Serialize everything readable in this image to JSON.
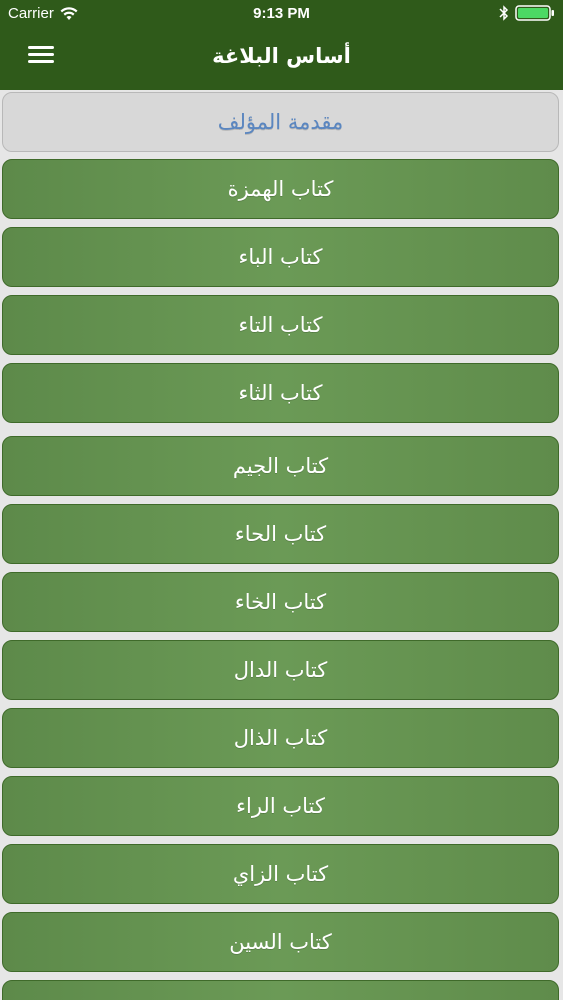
{
  "status_bar": {
    "carrier": "Carrier",
    "time": "9:13 PM",
    "icons": [
      "wifi-icon",
      "bluetooth-icon",
      "battery-icon"
    ]
  },
  "nav": {
    "title": "أساس البلاغة",
    "menu_icon": "hamburger-menu-icon"
  },
  "colors": {
    "nav_background": "#2f5a1a",
    "item_background": "#6b9a56",
    "selected_background": "#d8d8d8",
    "selected_text": "#5a86c0"
  },
  "items": [
    {
      "label": "مقدمة المؤلف",
      "selected": true
    },
    {
      "label": "كتاب الهمزة"
    },
    {
      "label": "كتاب الباء"
    },
    {
      "label": "كتاب التاء"
    },
    {
      "label": "كتاب الثاء"
    },
    {
      "label": "كتاب الجيم"
    },
    {
      "label": "كتاب الحاء"
    },
    {
      "label": "كتاب الخاء"
    },
    {
      "label": "كتاب الدال"
    },
    {
      "label": "كتاب الذال"
    },
    {
      "label": "كتاب الراء"
    },
    {
      "label": "كتاب الزاي"
    },
    {
      "label": "كتاب السين"
    }
  ]
}
